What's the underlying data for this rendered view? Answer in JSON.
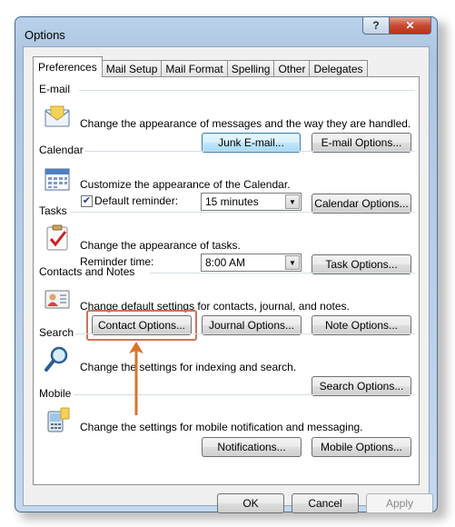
{
  "window": {
    "title": "Options",
    "help_glyph": "?",
    "close_glyph": "✕"
  },
  "tabs": [
    "Preferences",
    "Mail Setup",
    "Mail Format",
    "Spelling",
    "Other",
    "Delegates"
  ],
  "sections": {
    "email": {
      "label": "E-mail",
      "description": "Change the appearance of messages and the way they are handled.",
      "junk_button": "Junk E-mail...",
      "options_button": "E-mail Options..."
    },
    "calendar": {
      "label": "Calendar",
      "description": "Customize the appearance of the Calendar.",
      "reminder_label": "Default reminder:",
      "reminder_checked": true,
      "reminder_value": "15 minutes",
      "options_button": "Calendar Options..."
    },
    "tasks": {
      "label": "Tasks",
      "description": "Change the appearance of tasks.",
      "reminder_label": "Reminder time:",
      "reminder_value": "8:00 AM",
      "options_button": "Task Options..."
    },
    "contacts": {
      "label": "Contacts and Notes",
      "description": "Change default settings for contacts, journal, and notes.",
      "contact_button": "Contact Options...",
      "journal_button": "Journal Options...",
      "note_button": "Note Options..."
    },
    "search": {
      "label": "Search",
      "description": "Change the settings for indexing and search.",
      "options_button": "Search Options..."
    },
    "mobile": {
      "label": "Mobile",
      "description": "Change the settings for mobile notification and messaging.",
      "notifications_button": "Notifications...",
      "options_button": "Mobile Options..."
    }
  },
  "footer": {
    "ok": "OK",
    "cancel": "Cancel",
    "apply": "Apply"
  },
  "colors": {
    "highlight": "#c8755a",
    "arrow": "#d9742c"
  }
}
